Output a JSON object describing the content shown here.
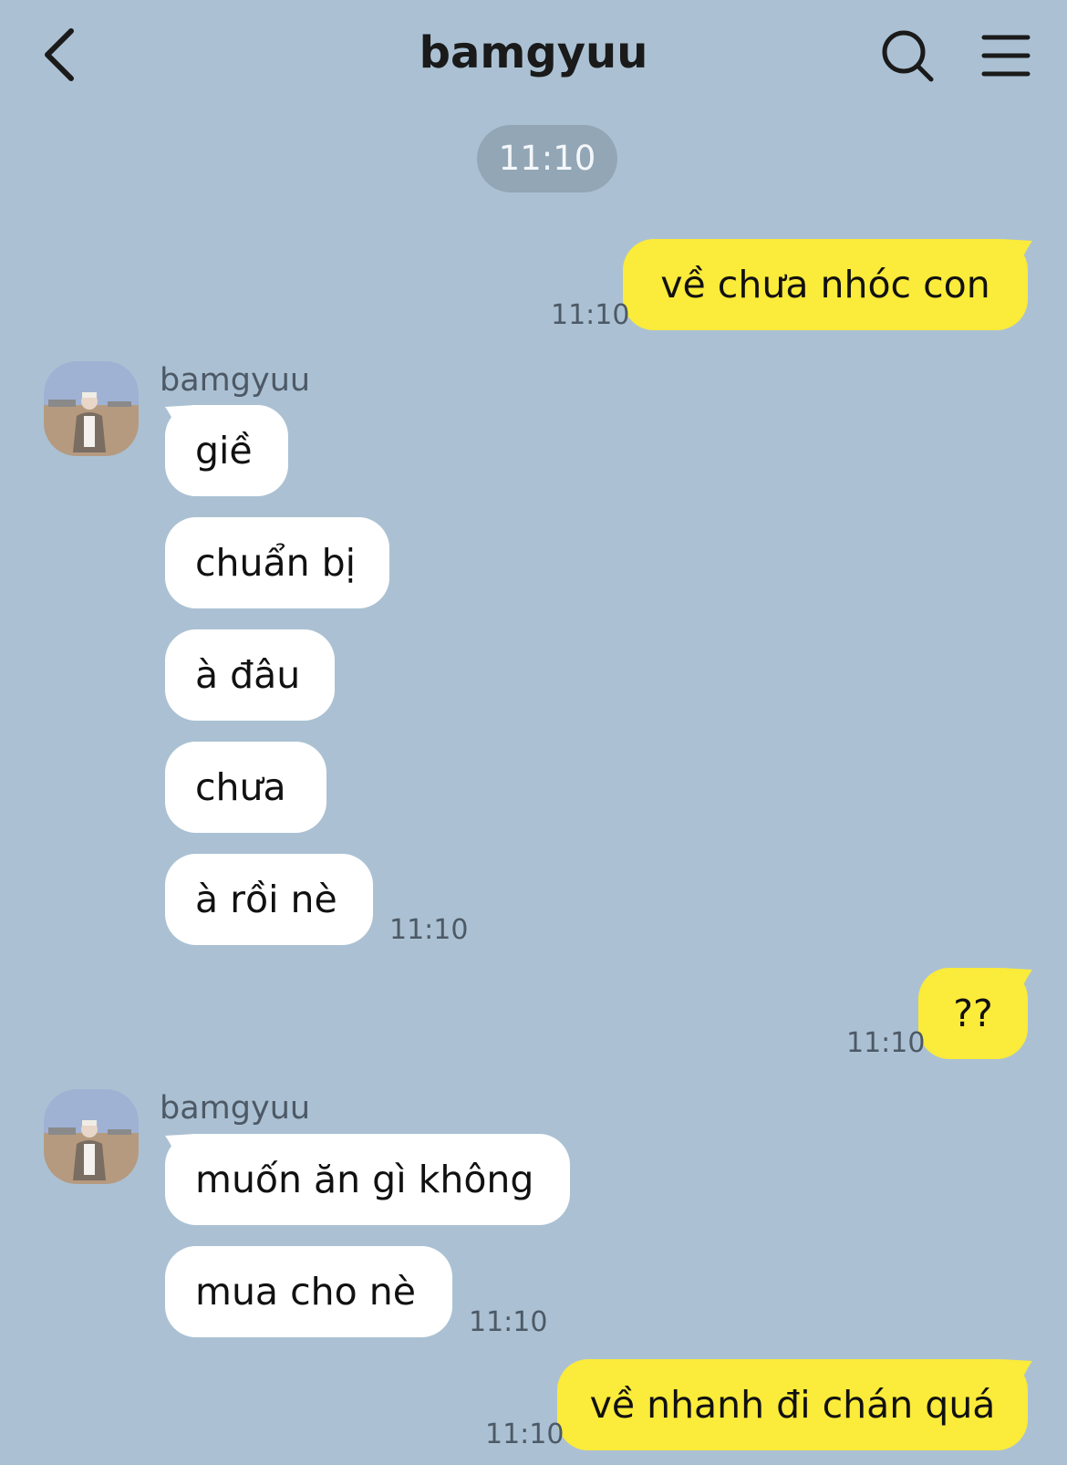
{
  "header": {
    "title": "bamgyuu",
    "back_icon": "chevron-left-icon",
    "search_icon": "search-icon",
    "menu_icon": "hamburger-menu-icon"
  },
  "date_pill": "11:10",
  "colors": {
    "background": "#abc1d3",
    "my_bubble": "#fbeb3a",
    "their_bubble": "#ffffff",
    "timestamp": "#4d5966"
  },
  "messages": [
    {
      "sender": "me",
      "text": "về chưa nhóc con",
      "time": "11:10"
    },
    {
      "sender": "bamgyuu",
      "texts": [
        "giề",
        "chuẩn bị",
        "à đâu",
        "chưa",
        "à rồi nè"
      ],
      "time": "11:10"
    },
    {
      "sender": "me",
      "text": "??",
      "time": "11:10"
    },
    {
      "sender": "bamgyuu",
      "texts": [
        "muốn ăn gì không",
        "mua cho nè"
      ],
      "time": "11:10"
    },
    {
      "sender": "me",
      "text": "về nhanh đi chán quá",
      "time": "11:10"
    }
  ]
}
